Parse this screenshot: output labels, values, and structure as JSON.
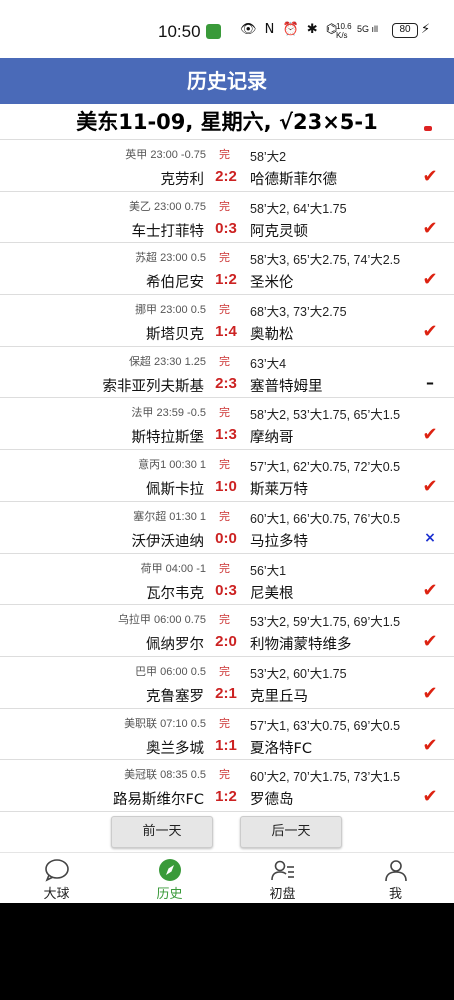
{
  "status_bar": {
    "time": "10:50",
    "icons": "👁 N ⏰ ✱ ⌬",
    "speed_top": "10.6",
    "speed_bottom": "K/s",
    "network": "5G ıll",
    "battery": "80"
  },
  "header": {
    "title": "历史记录"
  },
  "subheader": {
    "text": "美东11-09, 星期六, √23×5-1"
  },
  "matches": [
    {
      "league": "英甲 23:00 -0.75",
      "status": "完",
      "events": "58’大2",
      "home": "克劳利",
      "score": "2:2",
      "away": "哈德斯菲尔德",
      "result": "✔",
      "type": "win"
    },
    {
      "league": "美乙 23:00 0.75",
      "status": "完",
      "events": "58’大2, 64’大1.75",
      "home": "车士打菲特",
      "score": "0:3",
      "away": "阿克灵顿",
      "result": "✔",
      "type": "win"
    },
    {
      "league": "苏超 23:00 0.5",
      "status": "完",
      "events": "58’大3, 65’大2.75, 74’大2.5",
      "home": "希伯尼安",
      "score": "1:2",
      "away": "圣米伦",
      "result": "✔",
      "type": "win"
    },
    {
      "league": "挪甲 23:00 0.5",
      "status": "完",
      "events": "68’大3, 73’大2.75",
      "home": "斯塔贝克",
      "score": "1:4",
      "away": "奥勒松",
      "result": "✔",
      "type": "win"
    },
    {
      "league": "保超 23:30 1.25",
      "status": "完",
      "events": "63’大4",
      "home": "索非亚列夫斯基",
      "score": "2:3",
      "away": "塞普特姆里",
      "result": "–",
      "type": "draw"
    },
    {
      "league": "法甲 23:59 -0.5",
      "status": "完",
      "events": "58’大2, 53’大1.75, 65’大1.5",
      "home": "斯特拉斯堡",
      "score": "1:3",
      "away": "摩纳哥",
      "result": "✔",
      "type": "win"
    },
    {
      "league": "意丙1 00:30 1",
      "status": "完",
      "events": "57’大1, 62’大0.75, 72’大0.5",
      "home": "佩斯卡拉",
      "score": "1:0",
      "away": "斯莱万特",
      "result": "✔",
      "type": "win"
    },
    {
      "league": "塞尔超 01:30 1",
      "status": "完",
      "events": "60’大1, 66’大0.75, 76’大0.5",
      "home": "沃伊沃迪纳",
      "score": "0:0",
      "away": "马拉多特",
      "result": "×",
      "type": "lose"
    },
    {
      "league": "荷甲 04:00 -1",
      "status": "完",
      "events": "56’大1",
      "home": "瓦尔韦克",
      "score": "0:3",
      "away": "尼美根",
      "result": "✔",
      "type": "win"
    },
    {
      "league": "乌拉甲 06:00 0.75",
      "status": "完",
      "events": "53’大2, 59’大1.75, 69’大1.5",
      "home": "佩纳罗尔",
      "score": "2:0",
      "away": "利物浦蒙特维多",
      "result": "✔",
      "type": "win"
    },
    {
      "league": "巴甲 06:00 0.5",
      "status": "完",
      "events": "53’大2, 60’大1.75",
      "home": "克鲁塞罗",
      "score": "2:1",
      "away": "克里丘马",
      "result": "✔",
      "type": "win"
    },
    {
      "league": "美职联 07:10 0.5",
      "status": "完",
      "events": "57’大1, 63’大0.75, 69’大0.5",
      "home": "奥兰多城",
      "score": "1:1",
      "away": "夏洛特FC",
      "result": "✔",
      "type": "win"
    },
    {
      "league": "美冠联 08:35 0.5",
      "status": "完",
      "events": "60’大2, 70’大1.75, 73’大1.5",
      "home": "路易斯维尔FC",
      "score": "1:2",
      "away": "罗德岛",
      "result": "✔",
      "type": "win"
    }
  ],
  "buttons": {
    "prev": "前一天",
    "next": "后一天"
  },
  "tabs": [
    {
      "label": "大球",
      "icon": "chat-bubble-icon"
    },
    {
      "label": "历史",
      "icon": "compass-icon"
    },
    {
      "label": "初盘",
      "icon": "contacts-icon"
    },
    {
      "label": "我",
      "icon": "person-icon"
    }
  ],
  "colors": {
    "header": "#4a6ab8",
    "score": "#cc2222",
    "win_mark": "#dd2211",
    "lose_mark": "#1a2fd0",
    "active_tab": "#3a9a3a"
  }
}
